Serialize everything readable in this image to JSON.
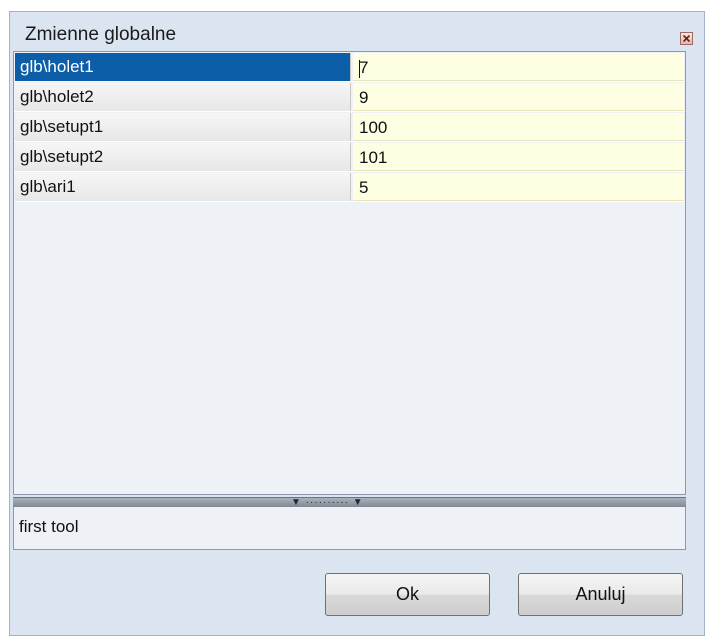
{
  "window": {
    "title": "Zmienne globalne"
  },
  "variables": [
    {
      "name": "glb\\holet1",
      "value": "7"
    },
    {
      "name": "glb\\holet2",
      "value": "9"
    },
    {
      "name": "glb\\setupt1",
      "value": "100"
    },
    {
      "name": "glb\\setupt2",
      "value": "101"
    },
    {
      "name": "glb\\ari1",
      "value": "5"
    }
  ],
  "selected_row": 0,
  "description": "first tool",
  "buttons": {
    "ok_label": "Ok",
    "cancel_label": "Anuluj"
  },
  "icons": {
    "close": "close-icon",
    "splitter": "splitter-grip-icon"
  },
  "colors": {
    "selection": "#0d5ea8",
    "value_cell": "#fefee3",
    "dialog_bg": "#dbe5f1"
  }
}
